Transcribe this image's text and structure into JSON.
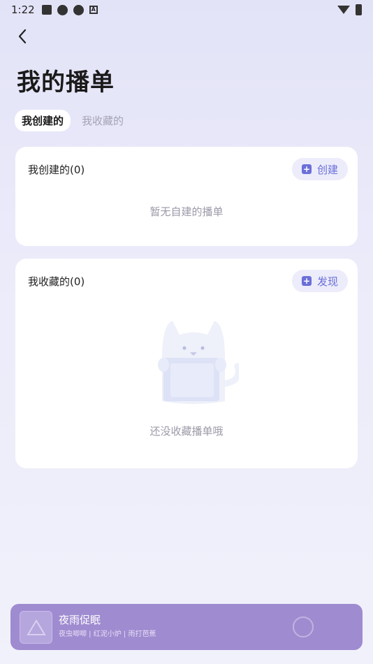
{
  "status": {
    "time": "1:22"
  },
  "header": {
    "back_icon": "chevron-left-icon",
    "title": "我的播单"
  },
  "tabs": [
    {
      "label": "我创建的",
      "active": true
    },
    {
      "label": "我收藏的",
      "active": false
    }
  ],
  "created_card": {
    "title": "我创建的(0)",
    "button_label": "创建",
    "empty_text": "暂无自建的播单"
  },
  "fav_card": {
    "title": "我收藏的(0)",
    "button_label": "发现",
    "empty_text": "还没收藏播单哦"
  },
  "player": {
    "title": "夜雨促眠",
    "subtitle": "夜虫唧唧 | 红泥小炉 | 雨打芭蕉"
  },
  "colors": {
    "accent": "#6b6fd8",
    "player_bg": "#9f8bd0"
  }
}
